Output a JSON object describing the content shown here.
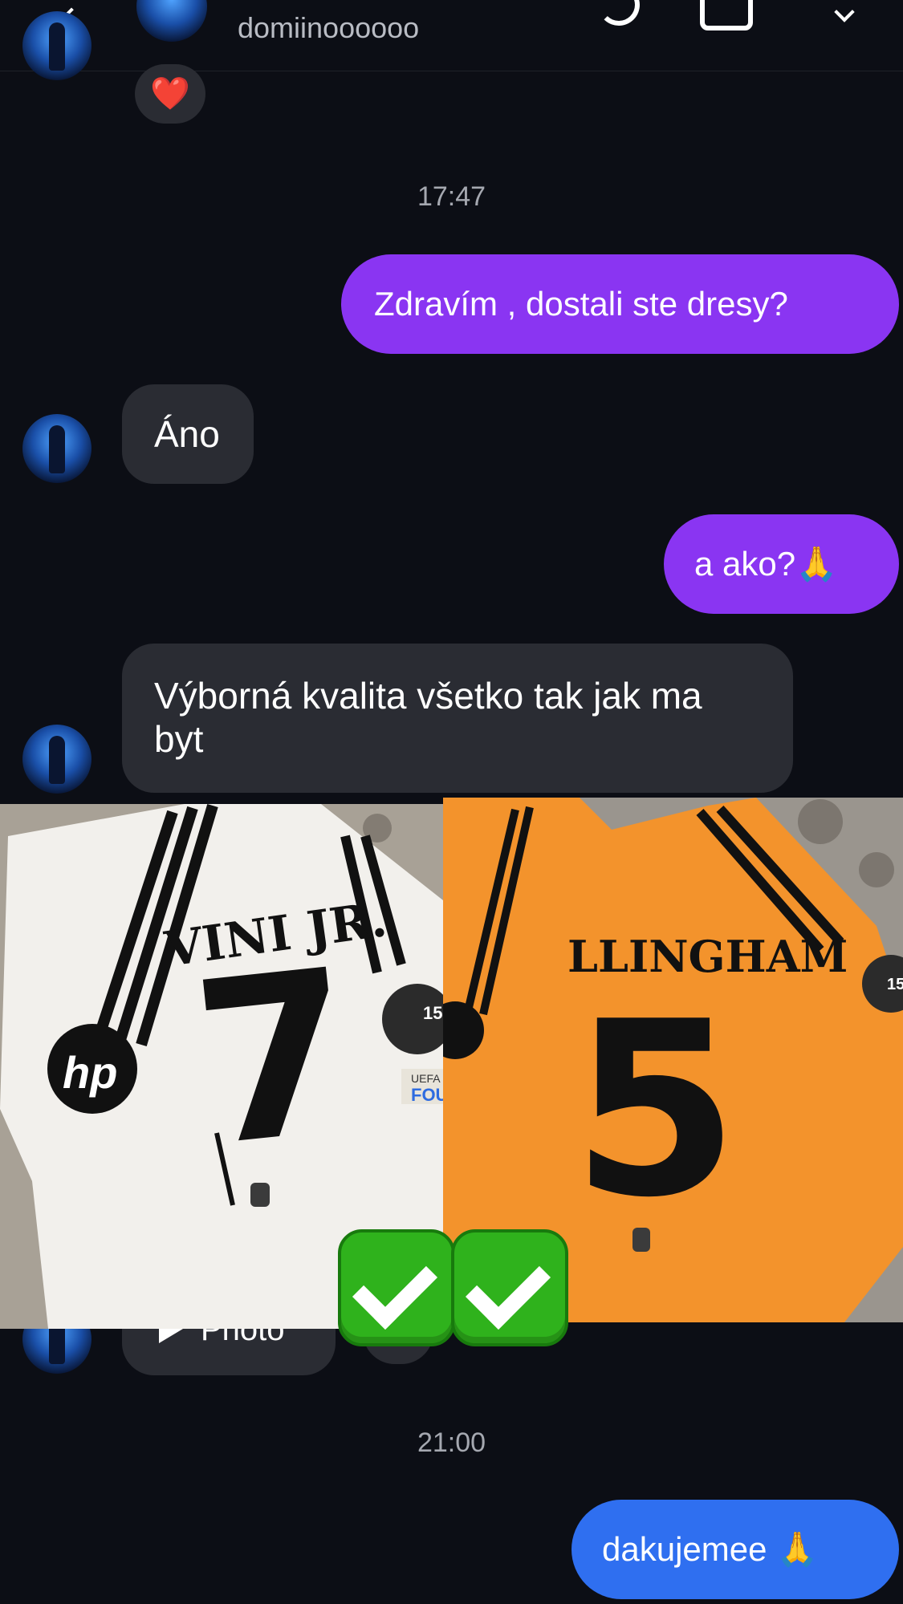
{
  "header": {
    "username": "domiinoooooo"
  },
  "reaction": {
    "emoji": "❤️"
  },
  "messages": {
    "ts1": "17:47",
    "out1": "Zdravím , dostali ste dresy?",
    "in1": "Áno",
    "out2": "a ako?🙏",
    "in2_line1": "Výborná kvalita všetko tak jak ma",
    "in2_line2": "byt",
    "ts2": "21:00",
    "out3": "dakujemee 🙏"
  },
  "photos": {
    "left": {
      "name": "VINI JR.",
      "number": "7",
      "sponsor": "hp",
      "patch_number": "15",
      "patch_text": "FOU",
      "patch_label": "UEFA"
    },
    "right": {
      "name": "LLINGHAM",
      "number": "5",
      "patch_number": "15"
    }
  },
  "hidden_bubble": {
    "text": "Photo"
  },
  "colors": {
    "bg": "#0c0e15",
    "bubble_in": "#2a2c33",
    "bubble_out": "#8a35f2",
    "bubble_blue": "#2f6ff0",
    "check_green": "#2fb21c"
  }
}
